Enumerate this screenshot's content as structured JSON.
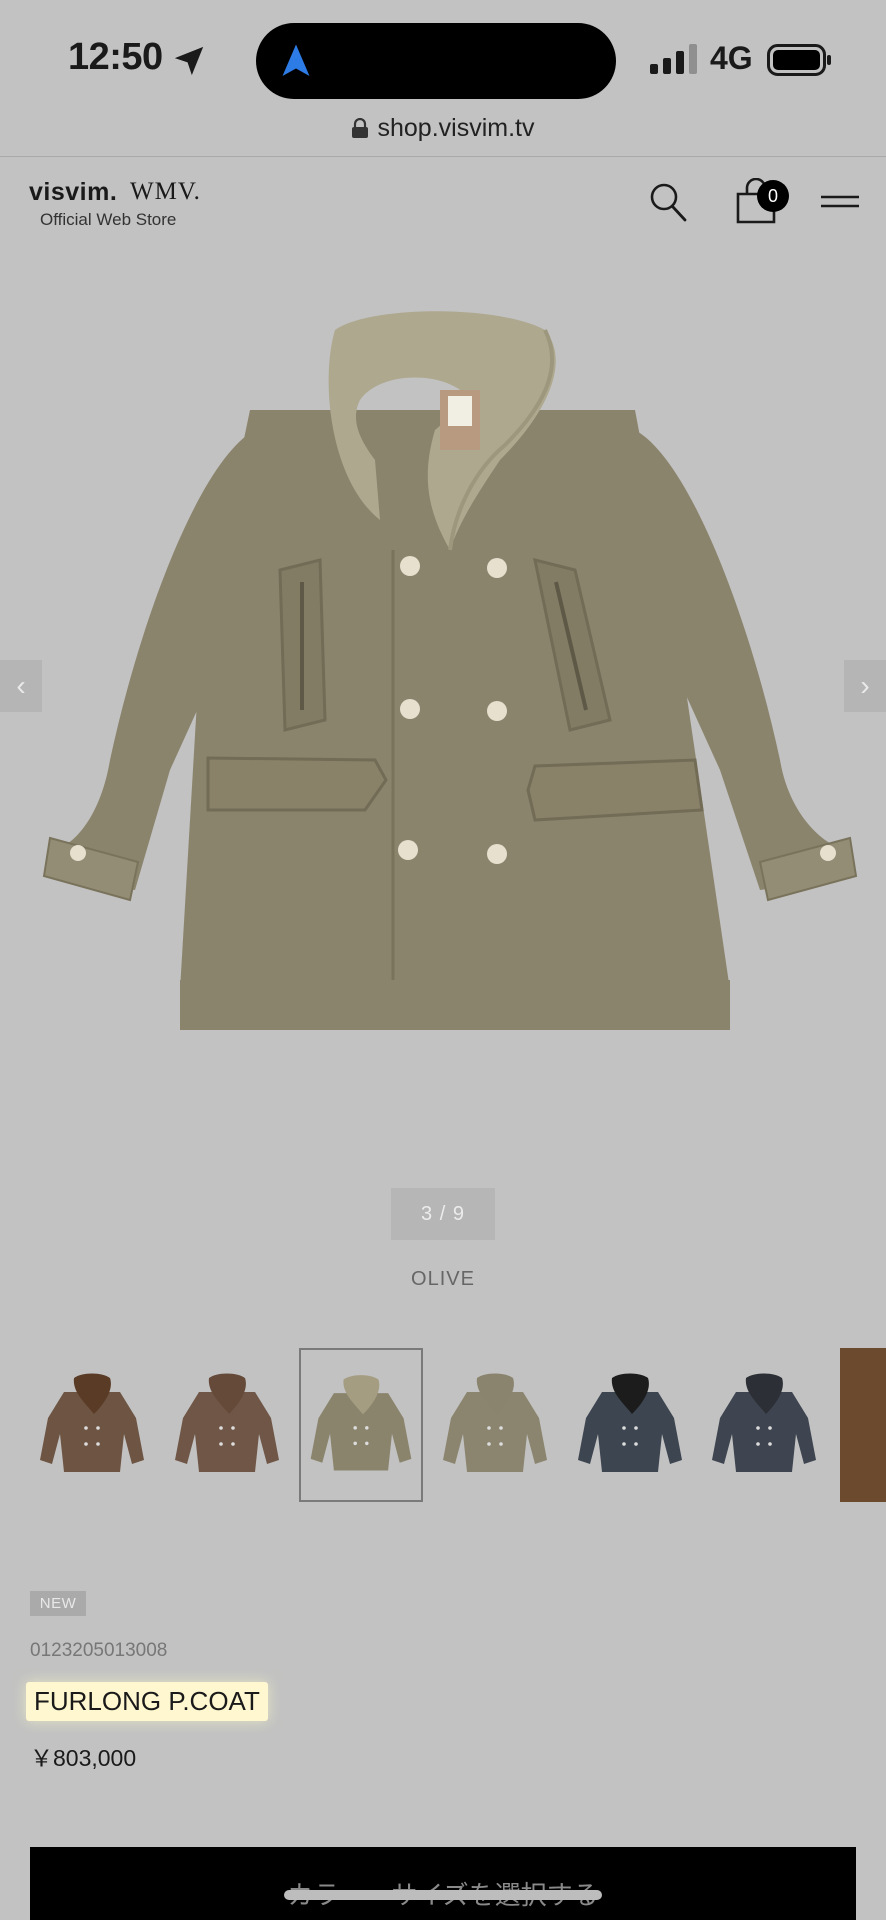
{
  "status_bar": {
    "time": "12:50",
    "network": "4G"
  },
  "browser": {
    "url": "shop.visvim.tv"
  },
  "header": {
    "logo_primary": "visvim.",
    "logo_secondary": "WMV.",
    "logo_subtitle": "Official Web Store",
    "cart_count": "0"
  },
  "gallery": {
    "counter": "3 / 9",
    "color_name": "OLIVE",
    "prev_glyph": "‹",
    "next_glyph": "›"
  },
  "thumbnails": [
    {
      "name": "thumb-brown-fur-collar",
      "body": "#6e5443",
      "collar": "#5a3b26",
      "selected": false
    },
    {
      "name": "thumb-brown",
      "body": "#6f5646",
      "collar": "#654a3a",
      "selected": false
    },
    {
      "name": "thumb-olive-shearling",
      "body": "#8b846d",
      "collar": "#a59d82",
      "selected": true
    },
    {
      "name": "thumb-olive",
      "body": "#8b856f",
      "collar": "#8a846e",
      "selected": false
    },
    {
      "name": "thumb-navy-black-collar",
      "body": "#3d4550",
      "collar": "#1c1c1c",
      "selected": false
    },
    {
      "name": "thumb-navy",
      "body": "#3e4550",
      "collar": "#2c3036",
      "selected": false
    },
    {
      "name": "thumb-fabric-detail",
      "body": "#6b4a2e",
      "collar": "#6b4a2e",
      "selected": false
    }
  ],
  "product": {
    "badge": "NEW",
    "code": "0123205013008",
    "name": "FURLONG P.COAT",
    "price": "￥803,000",
    "cta_label": "カラー・サイズを選択する"
  },
  "colors": {
    "background": "#c2c2c2",
    "coat_body": "#8b846d",
    "coat_collar": "#aea88f",
    "highlight": "#fff7cf",
    "cta": "#000000"
  }
}
